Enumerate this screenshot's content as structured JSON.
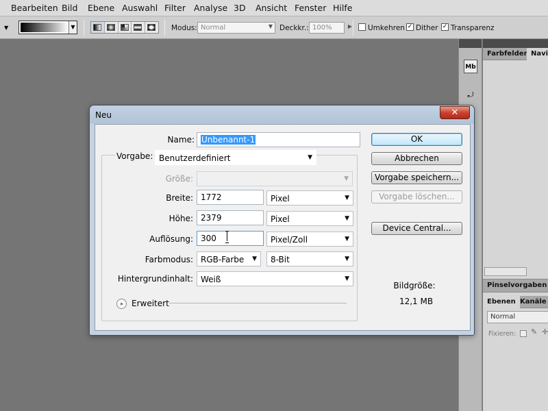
{
  "menubar": {
    "items": [
      "Bearbeiten",
      "Bild",
      "Ebene",
      "Auswahl",
      "Filter",
      "Analyse",
      "3D",
      "Ansicht",
      "Fenster",
      "Hilfe"
    ]
  },
  "options": {
    "mode_label": "Modus:",
    "mode_value": "Normal",
    "opacity_label": "Deckkr.:",
    "opacity_value": "100%",
    "reverse_label": "Umkehren",
    "reverse_checked": false,
    "dither_label": "Dither",
    "dither_checked": true,
    "transparency_label": "Transparenz",
    "transparency_checked": true,
    "check_mark": "✓"
  },
  "panels": {
    "top_tabs": [
      "Farbfelder",
      "Navig"
    ],
    "middle_tab": "Pinselvorgaben",
    "bottom_tabs": [
      "Ebenen",
      "Kanäle"
    ],
    "layer_mode": "Normal",
    "lock_label": "Fixieren:",
    "strip_icons": [
      "mini-bridge-icon",
      "history-icon"
    ]
  },
  "dialog": {
    "title": "Neu",
    "close_glyph": "✕",
    "name_label": "Name:",
    "name_value": "Unbenannt-1",
    "preset_label": "Vorgabe:",
    "preset_value": "Benutzerdefiniert",
    "size_label": "Größe:",
    "size_value": "",
    "width_label": "Breite:",
    "width_value": "1772",
    "width_unit": "Pixel",
    "height_label": "Höhe:",
    "height_value": "2379",
    "height_unit": "Pixel",
    "resolution_label": "Auflösung:",
    "resolution_value": "300",
    "resolution_unit": "Pixel/Zoll",
    "color_mode_label": "Farbmodus:",
    "color_mode_value": "RGB-Farbe",
    "bit_depth_value": "8-Bit",
    "background_label": "Hintergrundinhalt:",
    "background_value": "Weiß",
    "advanced_label": "Erweitert",
    "image_size_label": "Bildgröße:",
    "image_size_value": "12,1 MB",
    "buttons": {
      "ok": "OK",
      "cancel": "Abbrechen",
      "save_preset": "Vorgabe speichern...",
      "delete_preset": "Vorgabe löschen...",
      "device_central": "Device Central..."
    }
  }
}
